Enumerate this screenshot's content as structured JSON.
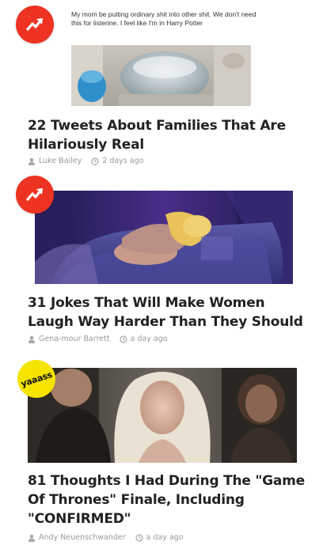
{
  "articles": [
    {
      "badge": "trending-icon",
      "thumb_caption": "My mom be putting ordinary shit into other shit. We don't need this for listerine. I feel like I'm in Harry Potter",
      "title": "22 Tweets About Families That Are Hilariously Real",
      "author": "Luke Bailey",
      "time": "2 days ago"
    },
    {
      "badge": "trending-icon",
      "title": "31 Jokes That Will Make Women Laugh Way Harder Than They Should",
      "author": "Gena-mour Barrett",
      "time": "a day ago"
    },
    {
      "badge": "yaaass-badge",
      "badge_text": "yaaass",
      "title": "81 Thoughts I Had During The \"Game Of Thrones\" Finale, Including \"CONFIRMED\"",
      "author": "Andy Neuenschwander",
      "time": "a day ago"
    }
  ],
  "colors": {
    "trending_red": "#ee3322",
    "yaaass_yellow": "#f5e400",
    "meta_gray": "#9a9a9a"
  }
}
